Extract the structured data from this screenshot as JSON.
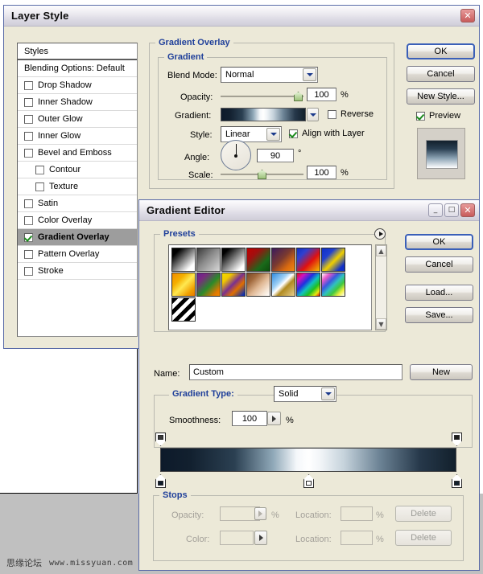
{
  "layer_style": {
    "title": "Layer Style",
    "close_label": "✕",
    "styles_header": "Styles",
    "blending_options": "Blending Options: Default",
    "effects": [
      {
        "label": "Drop Shadow",
        "checked": false,
        "indent": false
      },
      {
        "label": "Inner Shadow",
        "checked": false,
        "indent": false
      },
      {
        "label": "Outer Glow",
        "checked": false,
        "indent": false
      },
      {
        "label": "Inner Glow",
        "checked": false,
        "indent": false
      },
      {
        "label": "Bevel and Emboss",
        "checked": false,
        "indent": false
      },
      {
        "label": "Contour",
        "checked": false,
        "indent": true
      },
      {
        "label": "Texture",
        "checked": false,
        "indent": true
      },
      {
        "label": "Satin",
        "checked": false,
        "indent": false
      },
      {
        "label": "Color Overlay",
        "checked": false,
        "indent": false
      },
      {
        "label": "Gradient Overlay",
        "checked": true,
        "indent": false,
        "selected": true
      },
      {
        "label": "Pattern Overlay",
        "checked": false,
        "indent": false
      },
      {
        "label": "Stroke",
        "checked": false,
        "indent": false
      }
    ],
    "panel_title": "Gradient Overlay",
    "group_title": "Gradient",
    "blend_mode_label": "Blend Mode:",
    "blend_mode_value": "Normal",
    "opacity_label": "Opacity:",
    "opacity_value": "100",
    "opacity_unit": "%",
    "gradient_label": "Gradient:",
    "reverse_label": "Reverse",
    "reverse_checked": false,
    "style_label": "Style:",
    "style_value": "Linear",
    "align_label": "Align with Layer",
    "align_checked": true,
    "angle_label": "Angle:",
    "angle_value": "90",
    "angle_unit": "°",
    "scale_label": "Scale:",
    "scale_value": "100",
    "scale_unit": "%",
    "buttons": {
      "ok": "OK",
      "cancel": "Cancel",
      "new_style": "New Style..."
    },
    "preview_label": "Preview",
    "preview_checked": true
  },
  "gradient_editor": {
    "title": "Gradient Editor",
    "minimize_label": "_",
    "maximize_label": "□",
    "close_label": "✕",
    "presets_label": "Presets",
    "presets": [
      {
        "name": "foreground-to-background",
        "css": "linear-gradient(135deg,#000000 0%,#000000 18%,#ffffff 82%,#ffffff 100%)"
      },
      {
        "name": "foreground-to-transparent",
        "css": "linear-gradient(135deg,#3a3a3a 0%,#8a8a8a 45%,#d8d8d8 100%)"
      },
      {
        "name": "black-white",
        "css": "linear-gradient(135deg,#000000 0%,#000000 15%,#ffffff 85%,#ffffff 100%)"
      },
      {
        "name": "red-green",
        "css": "linear-gradient(135deg,#c00000 0%,#a01010 30%,#1a6a1a 70%,#0d4d0d 100%)"
      },
      {
        "name": "violet-orange",
        "css": "linear-gradient(135deg,#3b1a5c 0%,#7a3a30 45%,#d96a10 75%,#f08a10 100%)"
      },
      {
        "name": "blue-red-yellow",
        "css": "linear-gradient(135deg,#1030c0 0%,#3040d0 25%,#e01010 60%,#f0c000 100%)"
      },
      {
        "name": "blue-yellow-blue",
        "css": "linear-gradient(135deg,#1030c8 0%,#2040d0 28%,#f0d000 55%,#1030c8 85%,#1030c8 100%)"
      },
      {
        "name": "orange-yellow-orange",
        "css": "linear-gradient(135deg,#f08a00 0%,#f5b000 30%,#ffe850 52%,#f0a000 80%,#e87800 100%)"
      },
      {
        "name": "violet-green-orange",
        "css": "linear-gradient(135deg,#6a2090 0%,#7a2a80 22%,#2a8a2a 55%,#e07800 85%,#f08800 100%)"
      },
      {
        "name": "yellow-violet-orange-blue",
        "css": "linear-gradient(135deg,#f5d800 0%,#f0c800 22%,#7a3090 48%,#e07000 68%,#1030b0 95%)"
      },
      {
        "name": "copper",
        "css": "linear-gradient(135deg,#7a4a28 0%,#a0683c 25%,#e0b894 55%,#f5e4d4 80%,#ffffff 100%)"
      },
      {
        "name": "chrome",
        "css": "linear-gradient(135deg,#2e8adf 0%,#9fd0f5 35%,#ffffff 48%,#b08a20 62%,#e8d090 100%)"
      },
      {
        "name": "spectrum",
        "css": "linear-gradient(135deg,#e01010 0%,#d010c0 18%,#2030e0 38%,#10c0c0 55%,#20c020 72%,#e8e810 88%,#e01010 100%)"
      },
      {
        "name": "transparent-rainbow",
        "css": "linear-gradient(135deg,#ffffff 0%,#e858c8 18%,#3a58e0 36%,#30c0c0 52%,#40c840 68%,#f0f040 84%,#ffffff 100%)"
      },
      {
        "name": "transparent-stripes",
        "css": "repeating-linear-gradient(135deg,#000000 0 5px,#ffffff 5px 10px)"
      }
    ],
    "buttons": {
      "ok": "OK",
      "cancel": "Cancel",
      "load": "Load...",
      "save": "Save...",
      "new": "New"
    },
    "name_label": "Name:",
    "name_value": "Custom",
    "gradient_type_label": "Gradient Type:",
    "gradient_type_value": "Solid",
    "smoothness_label": "Smoothness:",
    "smoothness_value": "100",
    "smoothness_unit": "%",
    "gradient_css": "linear-gradient(90deg,#0d1a2a 0%,#12202f 10%,#2b4052 25%,#8fa8b8 38%,#f4f7fa 46%,#ffffff 50%,#f2f5f8 54%,#c6d3dc 62%,#6d8496 74%,#26384a 88%,#12202c 100%)",
    "stops_label": "Stops",
    "opacity_label": "Opacity:",
    "opacity_value": "",
    "opacity_unit": "%",
    "opacity_location_label": "Location:",
    "opacity_location_value": "",
    "opacity_location_unit": "%",
    "opacity_delete": "Delete",
    "color_label": "Color:",
    "color_location_label": "Location:",
    "color_location_value": "",
    "color_location_unit": "%",
    "color_delete": "Delete",
    "color_stops": [
      {
        "name": "stop-left",
        "color": "#0d1a2a",
        "position": 0
      },
      {
        "name": "stop-middle",
        "color": "#ffffff",
        "position": 50
      },
      {
        "name": "stop-right",
        "color": "#12202c",
        "position": 100
      }
    ],
    "opacity_stops": [
      {
        "name": "opacity-stop-left",
        "color": "#3a3a3a",
        "position": 0
      },
      {
        "name": "opacity-stop-right",
        "color": "#1c1c1c",
        "position": 100
      }
    ]
  },
  "watermark": {
    "forum": "思缘论坛",
    "site": "www.missyuan.com"
  }
}
